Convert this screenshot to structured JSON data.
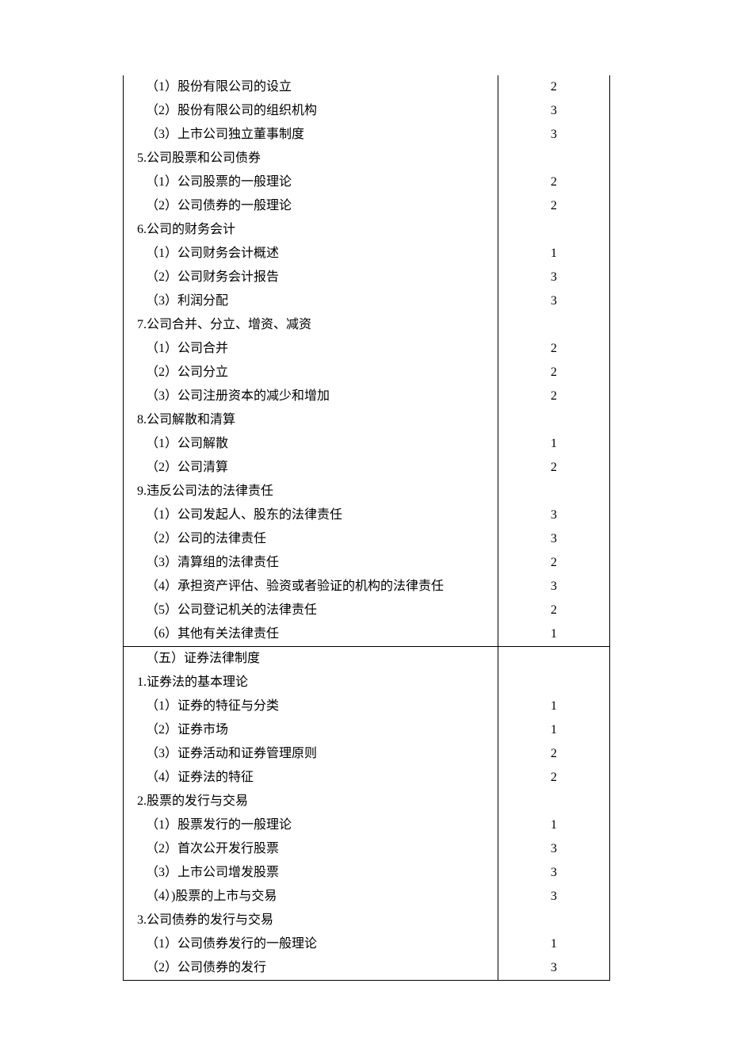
{
  "rows": [
    {
      "text": "（1）股份有限公司的设立",
      "num": "2",
      "indent": "sub",
      "break": false
    },
    {
      "text": "（2）股份有限公司的组织机构",
      "num": "3",
      "indent": "sub",
      "break": false
    },
    {
      "text": "（3）上市公司独立董事制度",
      "num": "3",
      "indent": "sub",
      "break": false
    },
    {
      "text": "5.公司股票和公司债券",
      "num": "",
      "indent": "section",
      "break": false
    },
    {
      "text": "（1）公司股票的一般理论",
      "num": "2",
      "indent": "sub",
      "break": false
    },
    {
      "text": "（2）公司债券的一般理论",
      "num": "2",
      "indent": "sub",
      "break": false
    },
    {
      "text": "6.公司的财务会计",
      "num": "",
      "indent": "section",
      "break": false
    },
    {
      "text": "（1）公司财务会计概述",
      "num": "1",
      "indent": "sub",
      "break": false
    },
    {
      "text": "（2）公司财务会计报告",
      "num": "3",
      "indent": "sub",
      "break": false
    },
    {
      "text": "（3）利润分配",
      "num": "3",
      "indent": "sub",
      "break": false
    },
    {
      "text": "7.公司合并、分立、增资、减资",
      "num": "",
      "indent": "section",
      "break": false
    },
    {
      "text": "（1）公司合并",
      "num": "2",
      "indent": "sub",
      "break": false
    },
    {
      "text": "（2）公司分立",
      "num": "2",
      "indent": "sub",
      "break": false
    },
    {
      "text": "（3）公司注册资本的减少和增加",
      "num": "2",
      "indent": "sub",
      "break": false
    },
    {
      "text": "8.公司解散和清算",
      "num": "",
      "indent": "section",
      "break": false
    },
    {
      "text": "（1）公司解散",
      "num": "1",
      "indent": "sub",
      "break": false
    },
    {
      "text": "（2）公司清算",
      "num": "2",
      "indent": "sub",
      "break": false
    },
    {
      "text": "9.违反公司法的法律责任",
      "num": "",
      "indent": "section",
      "break": false
    },
    {
      "text": "（1）公司发起人、股东的法律责任",
      "num": "3",
      "indent": "sub",
      "break": false
    },
    {
      "text": "（2）公司的法律责任",
      "num": "3",
      "indent": "sub",
      "break": false
    },
    {
      "text": "（3）清算组的法律责任",
      "num": "2",
      "indent": "sub",
      "break": false
    },
    {
      "text": "（4）承担资产评估、验资或者验证的机构的法律责任",
      "num": "3",
      "indent": "sub",
      "break": false
    },
    {
      "text": "（5）公司登记机关的法律责任",
      "num": "2",
      "indent": "sub",
      "break": false
    },
    {
      "text": "（6）其他有关法律责任",
      "num": "1",
      "indent": "sub",
      "break": false
    },
    {
      "text": "（五）证券法律制度",
      "num": "",
      "indent": "sub",
      "break": true
    },
    {
      "text": "1.证券法的基本理论",
      "num": "",
      "indent": "section",
      "break": false
    },
    {
      "text": "（1）证券的特征与分类",
      "num": "1",
      "indent": "sub",
      "break": false
    },
    {
      "text": "（2）证券市场",
      "num": "1",
      "indent": "sub",
      "break": false
    },
    {
      "text": "（3）证券活动和证券管理原则",
      "num": "2",
      "indent": "sub",
      "break": false
    },
    {
      "text": "（4）证券法的特征",
      "num": "2",
      "indent": "sub",
      "break": false
    },
    {
      "text": "2.股票的发行与交易",
      "num": "",
      "indent": "section",
      "break": false
    },
    {
      "text": "（1）股票发行的一般理论",
      "num": "1",
      "indent": "sub",
      "break": false
    },
    {
      "text": "（2）首次公开发行股票",
      "num": "3",
      "indent": "sub",
      "break": false
    },
    {
      "text": "（3）上市公司增发股票",
      "num": "3",
      "indent": "sub",
      "break": false
    },
    {
      "text": "（4）)股票的上市与交易",
      "num": "3",
      "indent": "sub",
      "break": false
    },
    {
      "text": "3.公司债券的发行与交易",
      "num": "",
      "indent": "section",
      "break": false
    },
    {
      "text": "（1）公司债券发行的一般理论",
      "num": "1",
      "indent": "sub",
      "break": false
    },
    {
      "text": "（2）公司债券的发行",
      "num": "3",
      "indent": "sub",
      "break": false
    }
  ]
}
